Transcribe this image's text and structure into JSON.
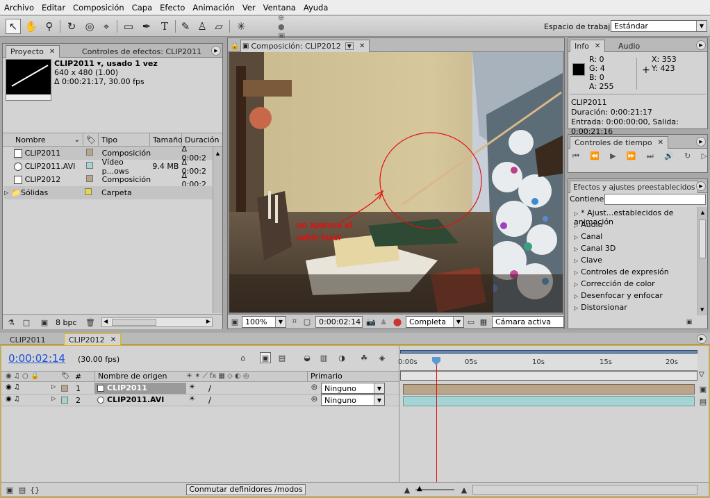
{
  "menu": [
    "Archivo",
    "Editar",
    "Composición",
    "Capa",
    "Efecto",
    "Animación",
    "Ver",
    "Ventana",
    "Ayuda"
  ],
  "toolbar": {
    "workspace_label": "Espacio de trabajo",
    "workspace_value": "Estándar"
  },
  "project": {
    "tab_project": "Proyecto",
    "tab_effects": "Controles de efectos: CLIP2011",
    "clip_name": "CLIP2011 ▾, usado 1 vez",
    "clip_dims": "640 x 480 (1.00)",
    "clip_duration": "Δ 0:00:21:17, 30.00 fps",
    "columns": [
      "Nombre",
      "Tipo",
      "Tamaño",
      "Duración"
    ],
    "items": [
      {
        "name": "CLIP2011",
        "type": "Composición",
        "size": "",
        "duration": "Δ 0:00:2",
        "color": "#b8a58a"
      },
      {
        "name": "CLIP2011.AVI",
        "type": "Vídeo p...ows",
        "size": "9.4 MB",
        "duration": "Δ 0:00:2",
        "color": "#a6d4d4"
      },
      {
        "name": "CLIP2012",
        "type": "Composición",
        "size": "",
        "duration": "Δ 0:00:2",
        "color": "#b8a58a"
      },
      {
        "name": "Sólidas",
        "type": "Carpeta",
        "size": "",
        "duration": "",
        "color": "#e8d64a"
      }
    ],
    "bpc": "8 bpc"
  },
  "comp": {
    "tab": "Composición: CLIP2012",
    "annotation_line1": "no aparece el",
    "annotation_line2": "sable laser",
    "zoom": "100%",
    "timecode": "0:00:02:14",
    "resolution": "Completa",
    "camera": "Cámara activa"
  },
  "info": {
    "tab_info": "Info",
    "tab_audio": "Audio",
    "r": "R:  0",
    "g": "G:  4",
    "b": "B:  0",
    "a": "A:  255",
    "x": "X:  353",
    "y": "Y:  423",
    "name": "CLIP2011",
    "duration": "Duración: 0:00:21:17",
    "inout": "Entrada: 0:00:00:00, Salida: 0:00:21:16"
  },
  "time_controls": {
    "tab": "Controles de tiempo"
  },
  "effects": {
    "tab": "Efectos y ajustes preestablecidos",
    "contains_label": "Contiene:",
    "items": [
      "* Ajust...establecidos de animación",
      "Audio",
      "Canal",
      "Canal 3D",
      "Clave",
      "Controles de expresión",
      "Corrección de color",
      "Desenfocar y enfocar",
      "Distorsionar"
    ]
  },
  "timeline": {
    "tab1": "CLIP2011",
    "tab2": "CLIP2012",
    "timecode": "0:00:02:14",
    "fps": "(30.00 fps)",
    "col_num": "#",
    "col_source": "Nombre de origen",
    "col_parent": "Primario",
    "layers": [
      {
        "num": "1",
        "name": "CLIP2011",
        "parent": "Ninguno",
        "color": "#b8a58a"
      },
      {
        "num": "2",
        "name": "CLIP2011.AVI",
        "parent": "Ninguno",
        "color": "#a6d4d4"
      }
    ],
    "ticks": [
      "0:00s",
      "05s",
      "10s",
      "15s",
      "20s"
    ],
    "switch_button": "Conmutar definidores /modos"
  }
}
